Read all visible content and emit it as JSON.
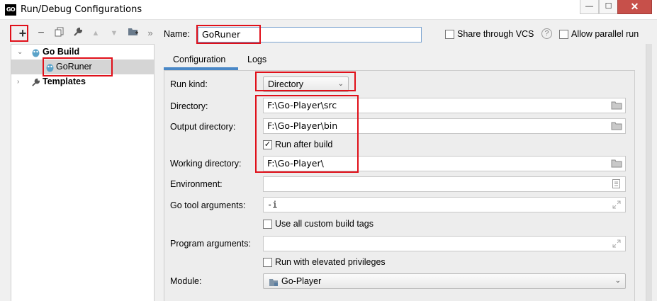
{
  "window": {
    "title": "Run/Debug Configurations",
    "app_logo": "GO",
    "minimize": "—",
    "maximize": "☐",
    "close": "✕"
  },
  "toolbar": {
    "icons": [
      "add-icon",
      "remove-icon",
      "copy-icon",
      "wrench-icon",
      "move-up-icon",
      "move-down-icon",
      "folder-icon",
      "more-icon"
    ],
    "more_label": "»"
  },
  "tree": {
    "groups": [
      {
        "label": "Go Build",
        "expanded": true,
        "children": [
          {
            "label": "GoRuner",
            "selected": true
          }
        ]
      },
      {
        "label": "Templates",
        "expanded": false,
        "children": []
      }
    ]
  },
  "header": {
    "name_label": "Name:",
    "name_value": "GoRuner",
    "share_label": "Share through VCS",
    "share_checked": false,
    "help_icon": "?",
    "parallel_label": "Allow parallel run",
    "parallel_checked": false
  },
  "tabs": [
    {
      "label": "Configuration",
      "active": true
    },
    {
      "label": "Logs",
      "active": false
    }
  ],
  "form": {
    "run_kind_label": "Run kind:",
    "run_kind_value": "Directory",
    "directory_label": "Directory:",
    "directory_value": "F:\\Go-Player\\src",
    "output_label": "Output directory:",
    "output_value": "F:\\Go-Player\\bin",
    "run_after_build_label": "Run after build",
    "run_after_build_checked": true,
    "working_label": "Working directory:",
    "working_value": "F:\\Go-Player\\",
    "environment_label": "Environment:",
    "environment_value": "",
    "go_tool_label": "Go tool arguments:",
    "go_tool_value": "-i",
    "custom_tags_label": "Use all custom build tags",
    "custom_tags_checked": false,
    "program_args_label": "Program arguments:",
    "program_args_value": "",
    "elevated_label": "Run with elevated privileges",
    "elevated_checked": false,
    "module_label": "Module:",
    "module_value": "Go-Player"
  },
  "colors": {
    "highlight_red": "#e0101a",
    "tab_accent": "#4a88c7",
    "selection": "#d5d5d5"
  }
}
